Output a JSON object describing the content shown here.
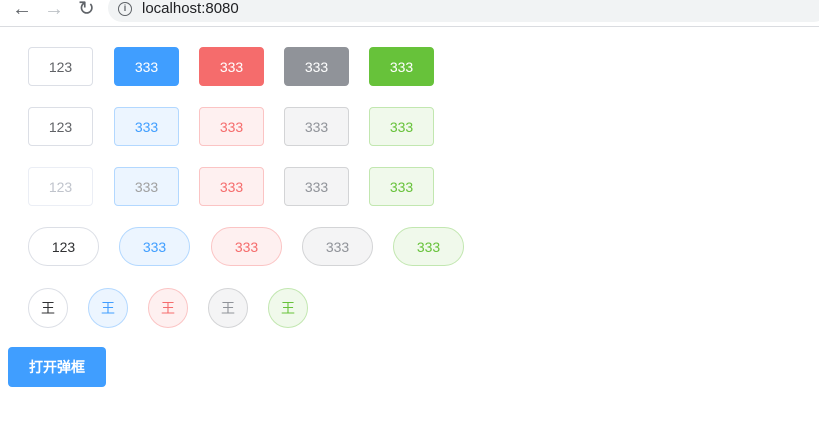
{
  "browser": {
    "url": "localhost:8080"
  },
  "rows": {
    "solid": [
      "123",
      "333",
      "333",
      "333",
      "333"
    ],
    "plain": [
      "123",
      "333",
      "333",
      "333",
      "333"
    ],
    "disabled": [
      "123",
      "333",
      "333",
      "333",
      "333"
    ],
    "round": [
      "123",
      "333",
      "333",
      "333",
      "333"
    ],
    "circle": [
      "王",
      "王",
      "王",
      "王",
      "王"
    ]
  },
  "open_dialog_label": "打开弹框"
}
